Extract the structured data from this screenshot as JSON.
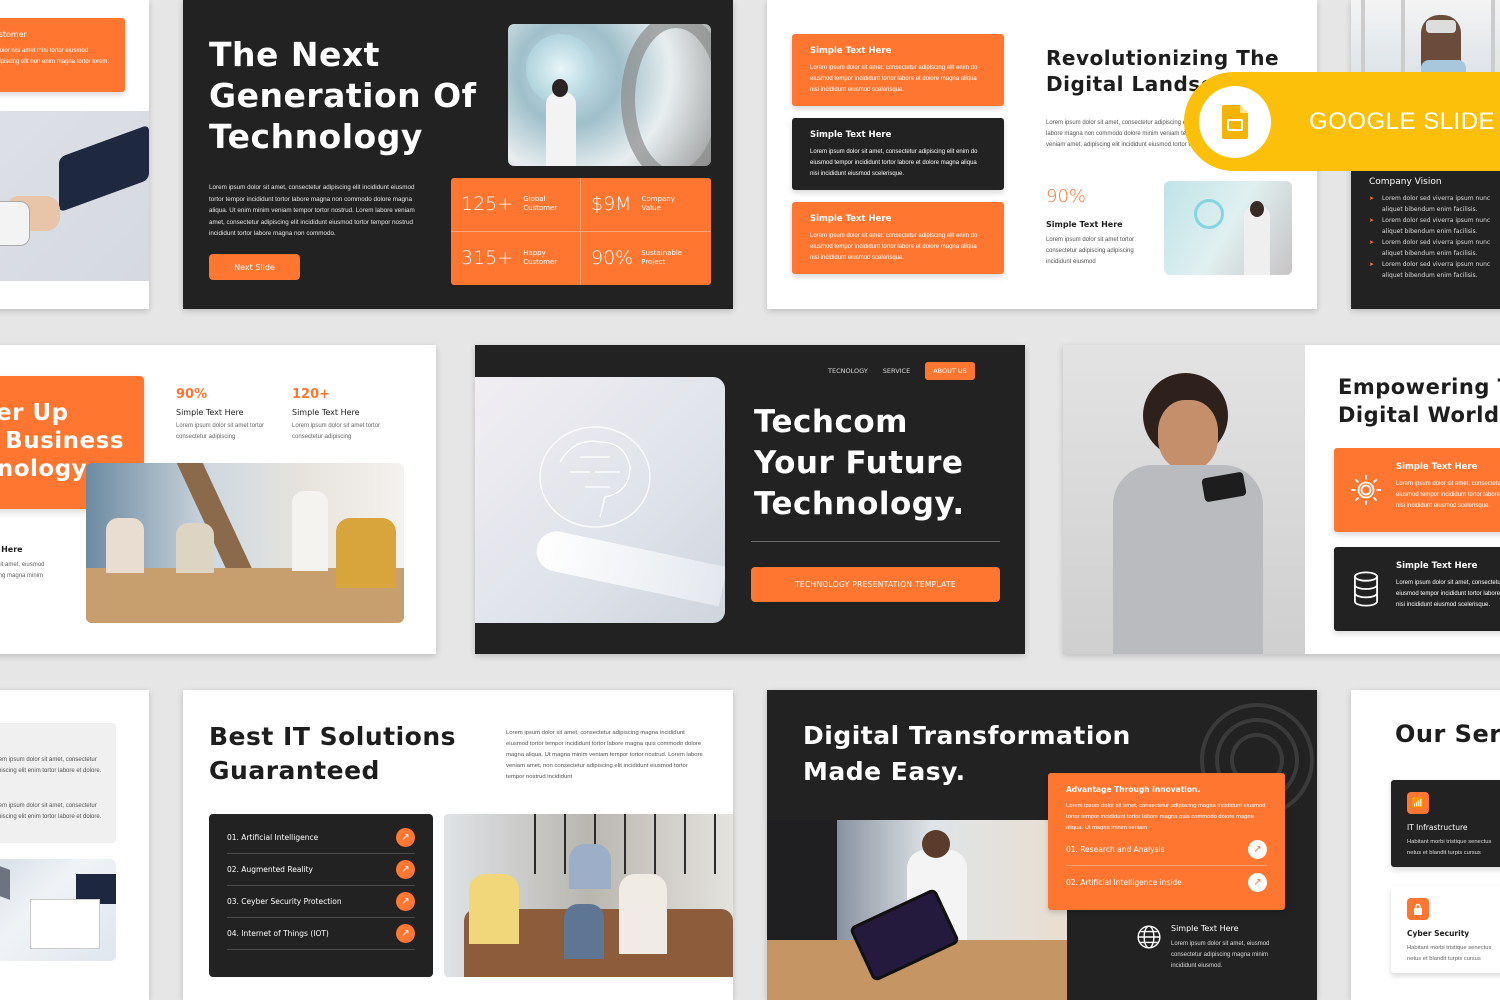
{
  "badge": {
    "label": "GOOGLE SLIDE",
    "color": "#fcbf0a"
  },
  "colors": {
    "accent": "#fe7630",
    "dark": "#222222",
    "light": "#ffffff",
    "background": "#e6e6e6"
  },
  "slide1": {
    "card_title": "Global Customer",
    "card_text": "Lorem ipsum dolor nisi amet mini tortor eiusmod consectetur adipiscing elit non enim magna tortor lorem."
  },
  "slide2": {
    "title_lines": [
      "The Next",
      "Generation Of",
      "Technology"
    ],
    "body": "Lorem ipsum dolor sit amet, consectetur adipiscing elit incididunt eiusmod tortor tempor incididunt tortor labore magna non commodo dolore magna aliqua. Ut enim minim veniam tempor tortor nostrud. Lorem labore veniam amet, consectetur adipiscing elit incididunt eiusmod tortor tempor nostrud incididunt tortor labore magna non commodo.",
    "button": "Next Slide",
    "stats": [
      {
        "value": "125+",
        "label1": "Global",
        "label2": "Customer"
      },
      {
        "value": "$9M",
        "label1": "Company",
        "label2": "Value"
      },
      {
        "value": "315+",
        "label1": "Happy",
        "label2": "Customer"
      },
      {
        "value": "90%",
        "label1": "Sustainable",
        "label2": "Project"
      }
    ]
  },
  "slide3": {
    "cards": [
      {
        "title": "Simple Text Here",
        "text": "Lorem ipsum dolor sit amet, consectetur adipiscing elit enim do eiusmod tempor incididunt tortor labore et dolore magna aliqua nisi incididunt eiusmod scelerisque."
      },
      {
        "title": "Simple Text Here",
        "text": "Lorem ipsum dolor sit amet, consectetur adipiscing elit enim do eiusmod tempor incididunt tortor labore et dolore magna aliqua nisi incididunt eiusmod scelerisque."
      },
      {
        "title": "Simple Text Here",
        "text": "Lorem ipsum dolor sit amet, consectetur adipiscing elit enim do eiusmod tempor incididunt tortor labore et dolore magna aliqua nisi incididunt eiusmod scelerisque."
      }
    ],
    "title_lines": [
      "Revolutionizing The",
      "Digital Landscape"
    ],
    "body": "Lorem ipsum dolor sit amet, consectetur adipiscing elit eiusmod tempor incididunt tortor labore magna non commodo dolore minim veniam tempor tortor nostrud. Lorem labore veniam amet, adipiscing elit incididunt eiusmod tortor tempor nostrud.",
    "stat_value": "90%",
    "stat_title": "Simple Text Here",
    "stat_text": "Lorem ipsum dolor sit amet tortor consectetur adipiscing adipiscing incididunt eiusmod"
  },
  "slide4": {
    "vision_title": "Company Vision",
    "bullets": [
      "Lorem dolor sed viverra ipsum nunc aliquet bibendum enim facilisis.",
      "Lorem dolor sed viverra ipsum nunc aliquet bibendum enim facilisis.",
      "Lorem dolor sed viverra ipsum nunc aliquet bibendum enim facilisis.",
      "Lorem dolor sed viverra ipsum nunc aliquet bibendum enim facilisis."
    ]
  },
  "slide5": {
    "title_lines": [
      "Power Up",
      "Your Business",
      "Technology."
    ],
    "stats": [
      {
        "value": "90%",
        "title": "Simple Text Here",
        "text": "Lorem ipsum dolor sit amet tortor consectetur adipiscing"
      },
      {
        "value": "120+",
        "title": "Simple Text Here",
        "text": "Lorem ipsum dolor sit amet tortor consectetur adipiscing"
      }
    ],
    "side_title": "Simple Text Here",
    "side_text": "Lorem ipsum dolor sit amet, eiusmod consectetur adipiscing magna minim incididunt eiusmod."
  },
  "slide6": {
    "nav": [
      "TECNOLOGY",
      "SERVICE",
      "ABOUT US"
    ],
    "title_lines": [
      "Techcom",
      "Your Future",
      "Technology."
    ],
    "button": "TECHNOLOGY PRESENTATION TEMPLATE"
  },
  "slide7": {
    "title_lines": [
      "Empowering The",
      "Digital World"
    ],
    "cards": [
      {
        "title": "Simple Text Here",
        "text": "Lorem ipsum dolor sit amet, consectetur adipiscing elit enim do eiusmod tempor incididunt tortor labore et dolore magna aliqua nisi incididunt eiusmod scelerisque."
      },
      {
        "title": "Simple Text Here",
        "text": "Lorem ipsum dolor sit amet, consectetur adipiscing elit enim do eiusmod tempor incididunt tortor labore et dolore magna aliqua nisi incididunt eiusmod scelerisque."
      }
    ]
  },
  "slide8": {
    "texts": [
      "Lorem ipsum dolor sit amet, consectetur adipiscing elit enim tortor labore et dolore.",
      "Lorem ipsum dolor sit amet, consectetur adipiscing elit enim tortor labore et dolore."
    ]
  },
  "slide9": {
    "title_lines": [
      "Best IT Solutions",
      "Guaranteed"
    ],
    "body": "Lorem ipsum dolor sit amet, consectetur adipiscing magna incididunt eiusmod tortor tempor incididunt tortor labore magna quis commodo dolore magna aliqua. Ut magna minim veniam tempor tortor nostrud. Lorem labore veniam amet, non consectetur adipiscing elit incididunt eiusmod tortor tempor nostrud incididunt",
    "items": [
      "01. Artificial Intelligence",
      "02. Augmented Reality",
      "03. Ceyber Security Protection",
      "04. Internet of Things (IOT)"
    ]
  },
  "slide10": {
    "title_lines": [
      "Digital Transformation",
      "Made Easy."
    ],
    "card_title": "Advantage Through Innovation.",
    "card_text": "Lorem ipsum dolor sit amet, consectetur adipiscing magna incididunt eiusmod tortor tempor incididunt tortor labore magna quis commodo dolore magna aliqua. Ut magna minim veniam",
    "items": [
      "01. Research and Analysis",
      "02. Artificial Intelligence inside"
    ],
    "side_title": "Simple Text Here",
    "side_text": "Lorem ipsum dolor sit amet, eiusmod consectetur adipiscing magna minim incididunt eiusmod."
  },
  "slide11": {
    "title": "Our Services",
    "services": [
      {
        "title": "IT Infrastructure",
        "text": "Habitant morbi tristique senectus netus et blandit turpis cursus"
      },
      {
        "title": "Cyber Security",
        "text": "Habitant morbi tristique senectus netus et blandit turpis cursus"
      }
    ]
  }
}
